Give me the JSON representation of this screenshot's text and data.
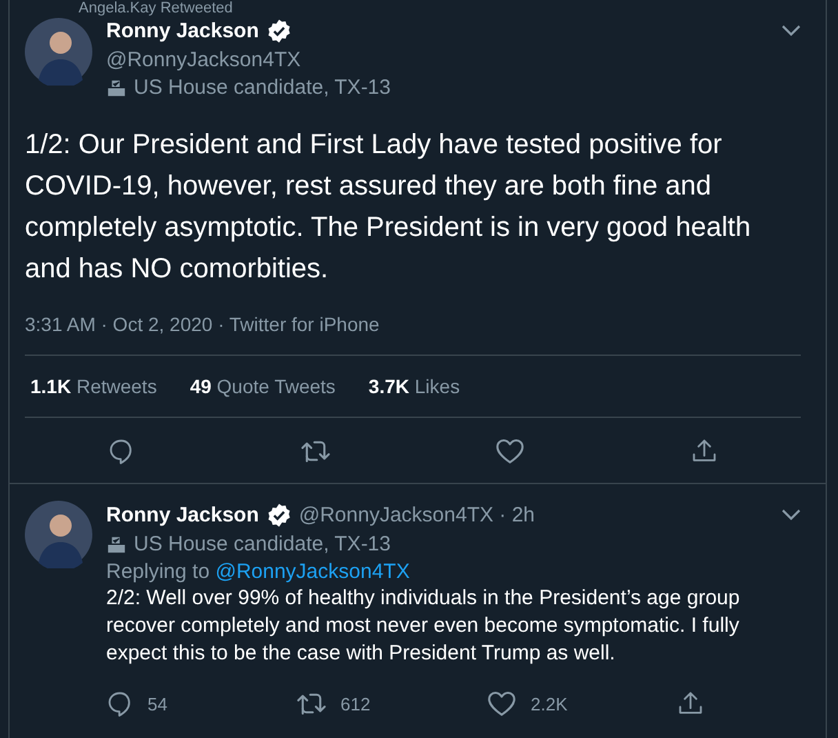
{
  "retweet_banner": {
    "text": "Angela.Kay Retweeted"
  },
  "tweets": [
    {
      "kind": "main",
      "name": "Ronny Jackson",
      "verified": true,
      "handle": "@RonnyJackson4TX",
      "label": "US House candidate, TX-13",
      "text": "1/2: Our President and First Lady have tested positive for COVID-19, however, rest assured they are both fine and completely asymptotic. The President is in very good health and has NO comorbities.",
      "meta": "3:31 AM · Oct 2, 2020 · Twitter for iPhone",
      "stats": [
        {
          "count": "1.1K",
          "label": "Retweets"
        },
        {
          "count": "49",
          "label": "Quote Tweets"
        },
        {
          "count": "3.7K",
          "label": "Likes"
        }
      ],
      "actions": [
        {
          "kind": "reply"
        },
        {
          "kind": "retweet"
        },
        {
          "kind": "like"
        },
        {
          "kind": "share"
        }
      ]
    },
    {
      "kind": "reply",
      "name": "Ronny Jackson",
      "verified": true,
      "handle": "@RonnyJackson4TX · 2h",
      "label": "US House candidate, TX-13",
      "replying_prefix": "Replying to",
      "replying_to": "@RonnyJackson4TX",
      "text": "2/2: Well over 99% of healthy individuals in the President’s age group recover completely and most never even become symptomatic. I fully expect this to be the case with President Trump as well.",
      "actions": [
        {
          "kind": "reply",
          "count": "54"
        },
        {
          "kind": "retweet",
          "count": "612"
        },
        {
          "kind": "like",
          "count": "2.2K"
        },
        {
          "kind": "share"
        }
      ]
    }
  ]
}
